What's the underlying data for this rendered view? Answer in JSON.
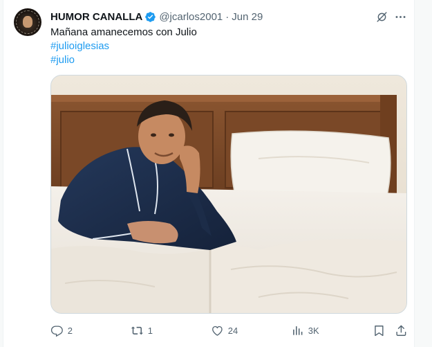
{
  "tweet": {
    "display_name": "HUMOR CANALLA",
    "handle": "@jcarlos2001",
    "separator": "·",
    "date": "Jun 29",
    "text": "Mañana amanecemos con Julio",
    "hashtags": [
      "#julioiglesias",
      "#julio"
    ],
    "media_icon": "photo-man-in-bed"
  },
  "actions": {
    "replies": "2",
    "reposts": "1",
    "likes": "24",
    "views": "3K"
  },
  "icons": {
    "verified": "verified-badge-icon",
    "grok": "grok-icon",
    "more": "more-icon",
    "reply": "reply-icon",
    "repost": "repost-icon",
    "like": "like-icon",
    "views": "views-icon",
    "bookmark": "bookmark-icon",
    "share": "share-icon"
  },
  "colors": {
    "link": "#1d9bf0",
    "text": "#0f1419",
    "secondary": "#536471",
    "verified": "#1d9bf0"
  }
}
